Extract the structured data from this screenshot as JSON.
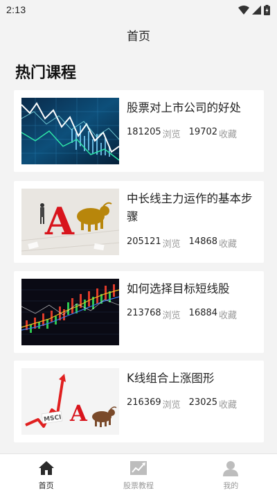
{
  "status_bar": {
    "time": "2:13"
  },
  "header": {
    "title": "首页"
  },
  "section": {
    "title": "热门课程"
  },
  "courses": [
    {
      "title": "股票对上市公司的好处",
      "views": "181205",
      "views_label": "浏览",
      "favorites": "19702",
      "favorites_label": "收藏"
    },
    {
      "title": "中长线主力运作的基本步骤",
      "views": "205121",
      "views_label": "浏览",
      "favorites": "14868",
      "favorites_label": "收藏"
    },
    {
      "title": "如何选择目标短线股",
      "views": "213768",
      "views_label": "浏览",
      "favorites": "16884",
      "favorites_label": "收藏"
    },
    {
      "title": "K线组合上涨图形",
      "views": "216369",
      "views_label": "浏览",
      "favorites": "23025",
      "favorites_label": "收藏"
    }
  ],
  "thumb_texts": {
    "a": "A",
    "msci": "MSCI"
  },
  "tabs": [
    {
      "label": "首页",
      "icon": "home-icon",
      "active": true
    },
    {
      "label": "股票教程",
      "icon": "chart-icon",
      "active": false
    },
    {
      "label": "我的",
      "icon": "user-icon",
      "active": false
    }
  ],
  "colors": {
    "active": "#222222",
    "inactive": "#999999",
    "accent_red": "#e02020"
  }
}
